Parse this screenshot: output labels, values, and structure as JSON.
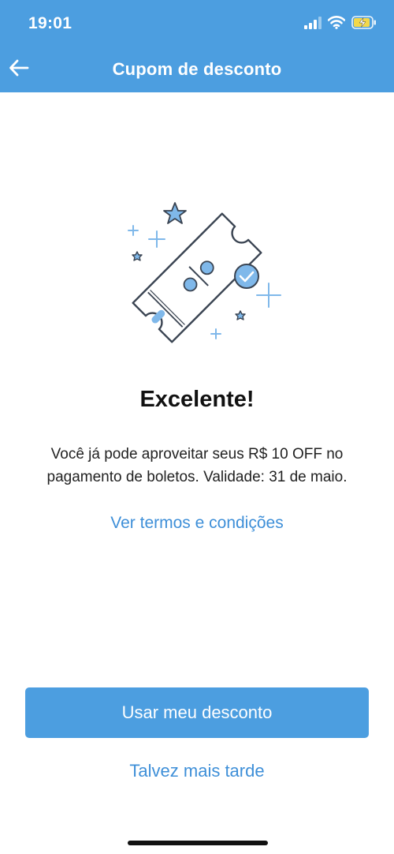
{
  "status_bar": {
    "time": "19:01",
    "icons": [
      "signal-icon",
      "wifi-icon",
      "battery-charging-icon"
    ]
  },
  "nav": {
    "title": "Cupom de desconto",
    "back_icon": "arrow-left-icon"
  },
  "illustration": {
    "icon": "coupon-ticket-icon",
    "decorations": [
      "star-icon",
      "plus-icon",
      "check-circle-icon",
      "percent-icon"
    ]
  },
  "content": {
    "headline": "Excelente!",
    "message": "Você já pode aproveitar seus R$ 10 OFF no pagamento de boletos. Validade: 31 de maio.",
    "terms_link": "Ver termos e condições"
  },
  "actions": {
    "primary_label": "Usar meu desconto",
    "secondary_label": "Talvez mais tarde"
  },
  "colors": {
    "brand_blue": "#4c9ee0",
    "link_blue": "#3e8fd8",
    "battery_yellow": "#f3d84a"
  }
}
